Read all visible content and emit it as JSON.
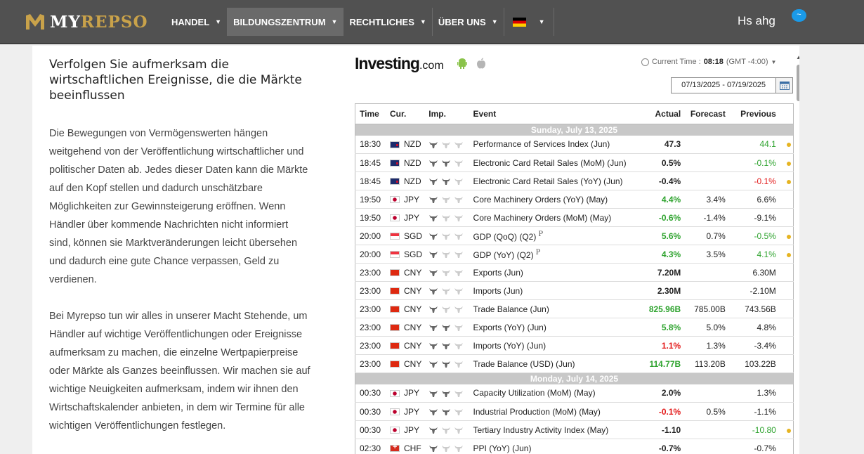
{
  "brand": {
    "my": "MY",
    "repso": "REPSO"
  },
  "nav": [
    {
      "label": "HANDEL"
    },
    {
      "label": "BILDUNGSZENTRUM"
    },
    {
      "label": "RECHTLICHES"
    },
    {
      "label": "ÜBER UNS"
    }
  ],
  "user": {
    "name": "Hs ahg",
    "badge": "~"
  },
  "article": {
    "heading": "Verfolgen Sie aufmerksam die wirtschaftlichen Ereignisse, die die Märkte beeinflussen",
    "p1": "Die Bewegungen von Vermögenswerten hängen weitgehend von der Veröffentlichung wirtschaftlicher und politischer Daten ab. Jedes dieser Daten kann die Märkte auf den Kopf stellen und dadurch unschätzbare Möglichkeiten zur Gewinnsteigerung eröffnen. Wenn Händler über kommende Nachrichten nicht informiert sind, können sie Marktveränderungen leicht übersehen und dadurch eine gute Chance verpassen, Geld zu verdienen.",
    "p2": "Bei Myrepso tun wir alles in unserer Macht Stehende, um Händler auf wichtige Veröffentlichungen oder Ereignisse aufmerksam zu machen, die einzelne Wertpapierpreise oder Märkte als Ganzes beeinflussen. Wir machen sie auf wichtige Neuigkeiten aufmerksam, indem wir ihnen den Wirtschaftskalender anbieten, in dem wir Termine für alle wichtigen Veröffentlichungen festlegen."
  },
  "widget": {
    "logo": "Investing",
    "logo_suffix": ".com",
    "time_label": "Current Time :",
    "time_value": "08:18",
    "timezone": "(GMT -4:00)",
    "date_range": "07/13/2025 - 07/19/2025",
    "headers": {
      "time": "Time",
      "cur": "Cur.",
      "imp": "Imp.",
      "event": "Event",
      "actual": "Actual",
      "forecast": "Forecast",
      "previous": "Previous"
    },
    "days": [
      {
        "label": "Sunday, July 13, 2025",
        "rows": [
          {
            "time": "18:30",
            "cur": "NZD",
            "flag": "nz",
            "imp": 1,
            "event": "Performance of Services Index (Jun)",
            "actual": "47.3",
            "actual_color": "",
            "forecast": "",
            "previous": "44.1",
            "prev_color": "green",
            "dot": true,
            "prelim": false
          },
          {
            "time": "18:45",
            "cur": "NZD",
            "flag": "nz",
            "imp": 2,
            "event": "Electronic Card Retail Sales (MoM) (Jun)",
            "actual": "0.5%",
            "actual_color": "",
            "forecast": "",
            "previous": "-0.1%",
            "prev_color": "green",
            "dot": true,
            "prelim": false
          },
          {
            "time": "18:45",
            "cur": "NZD",
            "flag": "nz",
            "imp": 2,
            "event": "Electronic Card Retail Sales (YoY) (Jun)",
            "actual": "-0.4%",
            "actual_color": "",
            "forecast": "",
            "previous": "-0.1%",
            "prev_color": "red",
            "dot": true,
            "prelim": false
          },
          {
            "time": "19:50",
            "cur": "JPY",
            "flag": "jp",
            "imp": 1,
            "event": "Core Machinery Orders (YoY) (May)",
            "actual": "4.4%",
            "actual_color": "green",
            "forecast": "3.4%",
            "previous": "6.6%",
            "prev_color": "",
            "dot": false,
            "prelim": false
          },
          {
            "time": "19:50",
            "cur": "JPY",
            "flag": "jp",
            "imp": 1,
            "event": "Core Machinery Orders (MoM) (May)",
            "actual": "-0.6%",
            "actual_color": "green",
            "forecast": "-1.4%",
            "previous": "-9.1%",
            "prev_color": "",
            "dot": false,
            "prelim": false
          },
          {
            "time": "20:00",
            "cur": "SGD",
            "flag": "sg",
            "imp": 1,
            "event": "GDP (QoQ) (Q2)",
            "actual": "5.6%",
            "actual_color": "green",
            "forecast": "0.7%",
            "previous": "-0.5%",
            "prev_color": "green",
            "dot": true,
            "prelim": true
          },
          {
            "time": "20:00",
            "cur": "SGD",
            "flag": "sg",
            "imp": 1,
            "event": "GDP (YoY) (Q2)",
            "actual": "4.3%",
            "actual_color": "green",
            "forecast": "3.5%",
            "previous": "4.1%",
            "prev_color": "green",
            "dot": true,
            "prelim": true
          },
          {
            "time": "23:00",
            "cur": "CNY",
            "flag": "cn",
            "imp": 1,
            "event": "Exports (Jun)",
            "actual": "7.20M",
            "actual_color": "",
            "forecast": "",
            "previous": "6.30M",
            "prev_color": "",
            "dot": false,
            "prelim": false
          },
          {
            "time": "23:00",
            "cur": "CNY",
            "flag": "cn",
            "imp": 1,
            "event": "Imports (Jun)",
            "actual": "2.30M",
            "actual_color": "",
            "forecast": "",
            "previous": "-2.10M",
            "prev_color": "",
            "dot": false,
            "prelim": false
          },
          {
            "time": "23:00",
            "cur": "CNY",
            "flag": "cn",
            "imp": 1,
            "event": "Trade Balance (Jun)",
            "actual": "825.96B",
            "actual_color": "green",
            "forecast": "785.00B",
            "previous": "743.56B",
            "prev_color": "",
            "dot": false,
            "prelim": false
          },
          {
            "time": "23:00",
            "cur": "CNY",
            "flag": "cn",
            "imp": 2,
            "event": "Exports (YoY) (Jun)",
            "actual": "5.8%",
            "actual_color": "green",
            "forecast": "5.0%",
            "previous": "4.8%",
            "prev_color": "",
            "dot": false,
            "prelim": false
          },
          {
            "time": "23:00",
            "cur": "CNY",
            "flag": "cn",
            "imp": 2,
            "event": "Imports (YoY) (Jun)",
            "actual": "1.1%",
            "actual_color": "red",
            "forecast": "1.3%",
            "previous": "-3.4%",
            "prev_color": "",
            "dot": false,
            "prelim": false
          },
          {
            "time": "23:00",
            "cur": "CNY",
            "flag": "cn",
            "imp": 2,
            "event": "Trade Balance (USD) (Jun)",
            "actual": "114.77B",
            "actual_color": "green",
            "forecast": "113.20B",
            "previous": "103.22B",
            "prev_color": "",
            "dot": false,
            "prelim": false
          }
        ]
      },
      {
        "label": "Monday, July 14, 2025",
        "rows": [
          {
            "time": "00:30",
            "cur": "JPY",
            "flag": "jp",
            "imp": 2,
            "event": "Capacity Utilization (MoM) (May)",
            "actual": "2.0%",
            "actual_color": "",
            "forecast": "",
            "previous": "1.3%",
            "prev_color": "",
            "dot": false,
            "prelim": false
          },
          {
            "time": "00:30",
            "cur": "JPY",
            "flag": "jp",
            "imp": 2,
            "event": "Industrial Production (MoM) (May)",
            "actual": "-0.1%",
            "actual_color": "red",
            "forecast": "0.5%",
            "previous": "-1.1%",
            "prev_color": "",
            "dot": false,
            "prelim": false
          },
          {
            "time": "00:30",
            "cur": "JPY",
            "flag": "jp",
            "imp": 1,
            "event": "Tertiary Industry Activity Index (May)",
            "actual": "-1.10",
            "actual_color": "",
            "forecast": "",
            "previous": "-10.80",
            "prev_color": "green",
            "dot": true,
            "prelim": false
          },
          {
            "time": "02:30",
            "cur": "CHF",
            "flag": "ch",
            "imp": 1,
            "event": "PPI (YoY) (Jun)",
            "actual": "-0.7%",
            "actual_color": "",
            "forecast": "",
            "previous": "-0.7%",
            "prev_color": "",
            "dot": false,
            "prelim": false
          }
        ]
      }
    ]
  }
}
